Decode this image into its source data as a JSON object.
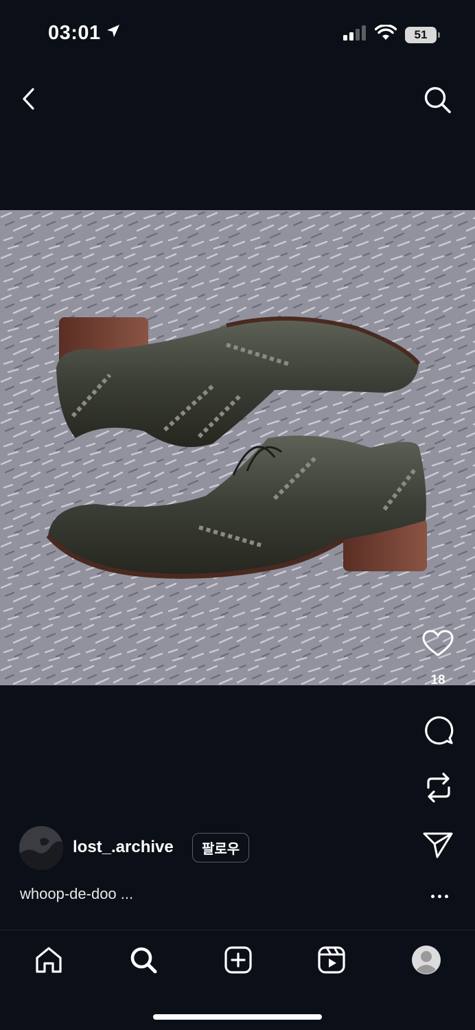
{
  "status_bar": {
    "time": "03:01",
    "battery": "51"
  },
  "header": {
    "back_icon": "chevron-left-icon",
    "search_icon": "search-icon"
  },
  "post": {
    "media_description": "photo",
    "like_count": "18",
    "author": {
      "username": "lost_.archive",
      "follow_label": "팔로우"
    },
    "caption": "whoop-de-doo ..."
  },
  "bottom_nav": {
    "items": [
      "home-icon",
      "search-icon",
      "create-icon",
      "reels-icon",
      "profile-icon"
    ]
  },
  "colors": {
    "background": "#0b0f17",
    "text": "#ffffff",
    "follow_border": "#5a5d63"
  }
}
